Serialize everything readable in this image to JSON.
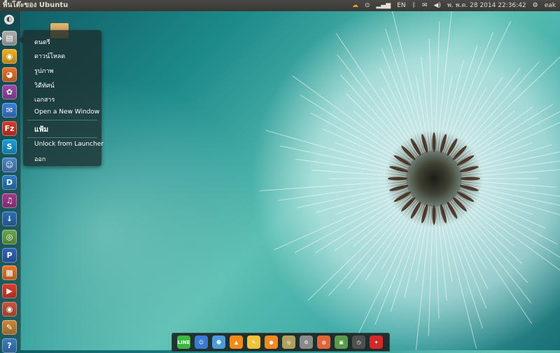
{
  "panel": {
    "title": "พื้นโต๊ะของ Ubuntu",
    "clock": "พ. พ.ค. 28 2014 22:36:42",
    "user": "eak",
    "indicators": [
      {
        "name": "weather-icon",
        "glyph": "☁",
        "color": "#f0a020"
      },
      {
        "name": "sync-icon",
        "glyph": "⊙",
        "color": "#e4e0d8"
      },
      {
        "name": "network-signal-icon",
        "glyph": "▂▄▆",
        "color": "#e4e0d8"
      },
      {
        "name": "keyboard-layout-icon",
        "glyph": "EN",
        "color": "#e4e0d8"
      },
      {
        "name": "bluetooth-icon",
        "glyph": "ᛒ",
        "color": "#e4e0d8"
      },
      {
        "name": "mail-icon",
        "glyph": "✉",
        "color": "#e4e0d8"
      },
      {
        "name": "volume-icon",
        "glyph": "◀)",
        "color": "#e4e0d8"
      }
    ]
  },
  "launcher": {
    "items": [
      {
        "name": "dash-home-icon",
        "glyph": "◐",
        "color": "#dcdcdc"
      },
      {
        "name": "files-icon",
        "glyph": "▤",
        "color": "#b0b0b0"
      },
      {
        "name": "chrome-icon",
        "glyph": "◉",
        "color": "#f2b01e"
      },
      {
        "name": "firefox-icon",
        "glyph": "◕",
        "color": "#e8742b"
      },
      {
        "name": "photo-viewer-icon",
        "glyph": "✿",
        "color": "#9a4aa8"
      },
      {
        "name": "chat-icon",
        "glyph": "✉",
        "color": "#3f7fd6"
      },
      {
        "name": "filezilla-icon",
        "glyph": "Fz",
        "color": "#d43a2a"
      },
      {
        "name": "skype-icon",
        "glyph": "S",
        "color": "#1a9ed9"
      },
      {
        "name": "user-accounts-icon",
        "glyph": "☺",
        "color": "#4f86c6"
      },
      {
        "name": "dictionary-icon",
        "glyph": "D",
        "color": "#2f7cc0"
      },
      {
        "name": "music-player-icon",
        "glyph": "♫",
        "color": "#a23c8c"
      },
      {
        "name": "download-manager-icon",
        "glyph": "↓",
        "color": "#2f6fb3"
      },
      {
        "name": "chromium-icon",
        "glyph": "◎",
        "color": "#6aa84f"
      },
      {
        "name": "deluge-icon",
        "glyph": "P",
        "color": "#3064b8"
      },
      {
        "name": "workspace-switcher-icon",
        "glyph": "▦",
        "color": "#e87a2a"
      },
      {
        "name": "media-player-icon",
        "glyph": "▶",
        "color": "#d9402d"
      },
      {
        "name": "screenshot-icon",
        "glyph": "◉",
        "color": "#c8563c"
      },
      {
        "name": "image-editor-icon",
        "glyph": "✎",
        "color": "#c98a3a"
      },
      {
        "name": "help-icon",
        "glyph": "?",
        "color": "#3c7ebf"
      }
    ]
  },
  "quicklist": {
    "items": [
      {
        "label": "ดนตรี",
        "bold": false
      },
      {
        "label": "ดาวน์โหลด",
        "bold": false
      },
      {
        "label": "รูปภาพ",
        "bold": false
      },
      {
        "label": "วิดีทัศน์",
        "bold": false
      },
      {
        "label": "เอกสาร",
        "bold": false
      },
      {
        "label": "Open a New Window",
        "bold": false
      },
      {
        "label": "แฟ้ม",
        "bold": true
      },
      {
        "label": "Unlock from Launcher",
        "bold": false
      },
      {
        "label": "ออก",
        "bold": false
      }
    ]
  },
  "dock": {
    "items": [
      {
        "name": "line-icon",
        "glyph": "LINE",
        "color": "#3cb83c"
      },
      {
        "name": "contacts-icon",
        "glyph": "☺",
        "color": "#3a7ad0"
      },
      {
        "name": "finder-icon",
        "glyph": "☻",
        "color": "#4a9bd8"
      },
      {
        "name": "vlc-icon",
        "glyph": "▲",
        "color": "#f08a1a"
      },
      {
        "name": "notes-icon",
        "glyph": "✎",
        "color": "#f2c23a"
      },
      {
        "name": "orange-app-icon",
        "glyph": "●",
        "color": "#f38a20"
      },
      {
        "name": "disc-icon",
        "glyph": "◎",
        "color": "#b0a060"
      },
      {
        "name": "automator-icon",
        "glyph": "⚙",
        "color": "#8a8a8a"
      },
      {
        "name": "browser-icon",
        "glyph": "◍",
        "color": "#e0663a"
      },
      {
        "name": "image-icon",
        "glyph": "▣",
        "color": "#5a9a4a"
      },
      {
        "name": "timer-icon",
        "glyph": "◷",
        "color": "#505050"
      },
      {
        "name": "pdf-icon",
        "glyph": "✦",
        "color": "#d02a2a"
      }
    ]
  }
}
